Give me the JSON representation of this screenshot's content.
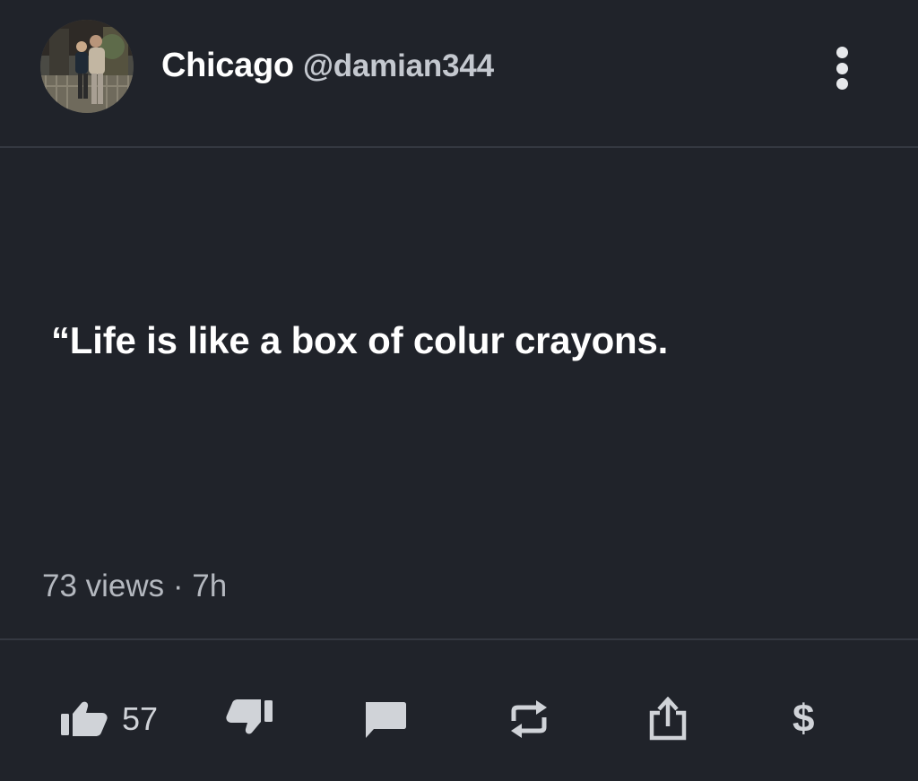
{
  "author": {
    "display_name": "Chicago",
    "handle": "@damian344"
  },
  "post": {
    "text": "“Life is like a box of colur crayons.",
    "views": "73 views",
    "separator": "·",
    "age": "7h"
  },
  "actions": {
    "like_count": "57",
    "tip_symbol": "$"
  },
  "icons": {
    "more": "more-vertical-icon",
    "like": "thumbs-up-icon",
    "dislike": "thumbs-down-icon",
    "reply": "comment-icon",
    "repost": "repost-icon",
    "share": "share-icon",
    "tip": "dollar-icon"
  },
  "colors": {
    "background": "#20232a",
    "divider": "#343841",
    "text_primary": "#ffffff",
    "text_secondary": "#b4b8bf",
    "icon": "#d0d3d8"
  }
}
